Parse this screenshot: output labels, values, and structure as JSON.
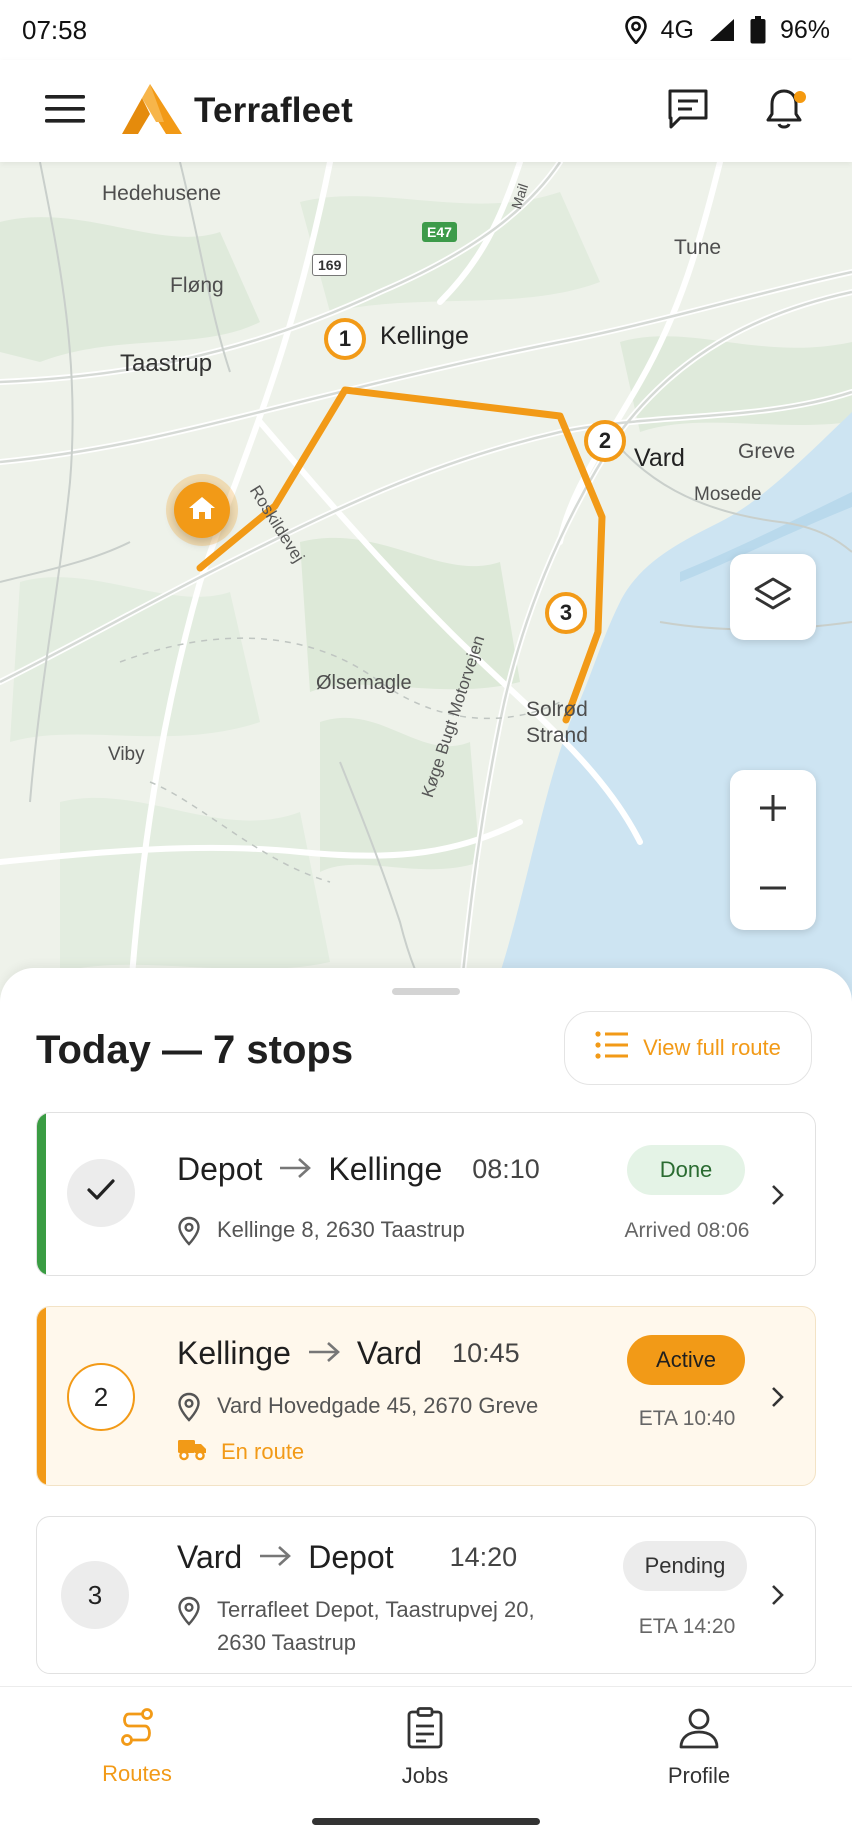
{
  "status_bar": {
    "time": "07:58",
    "network": "4G",
    "battery": "96%",
    "icons": [
      "location-icon",
      "signal-icon",
      "battery-icon"
    ]
  },
  "app_bar": {
    "brand": "Terrafleet",
    "icons": [
      "menu-icon",
      "logo-icon",
      "messages-icon",
      "notifications-icon"
    ],
    "notification_dot_color": "#f59a10"
  },
  "map": {
    "places": {
      "hedehusene": "Hedehusene",
      "flong": "Fløng",
      "taastrup": "Taastrup",
      "kellinge": "Kellinge",
      "tune": "Tune",
      "vard": "Vard",
      "greve": "Greve",
      "mosede": "Mosede",
      "olsemagle": "Ølsemagle",
      "viby": "Viby",
      "solrod_line1": "Solrød",
      "solrod_line2": "Strand"
    },
    "roads": {
      "roskildevej": "Roskildevej",
      "koge_bugt": "Køge Bugt Motorvejen",
      "top_road": "Mail"
    },
    "shields": {
      "e47": "E47",
      "r169": "169"
    },
    "markers": [
      "1",
      "2",
      "3"
    ],
    "route_color": "#f29a17",
    "controls": [
      "layers-icon",
      "zoom-in-icon",
      "zoom-out-icon"
    ]
  },
  "sheet": {
    "title": "Today — 7 stops",
    "view_route_label": "View full route",
    "stops": [
      {
        "number": "",
        "from": "Depot",
        "to": "Kellinge",
        "time": "08:10",
        "address": "Kellinge 8, 2630 Taastrup",
        "badge": "Done",
        "eta": "Arrived 08:06",
        "state": "done",
        "accent": "#3a9c43"
      },
      {
        "number": "2",
        "from": "Kellinge",
        "to": "Vard",
        "time": "10:45",
        "address": "Vard Hovedgade 45, 2670 Greve",
        "status": "En route",
        "badge": "Active",
        "eta": "ETA 10:40",
        "state": "active",
        "accent": "#f29a17"
      },
      {
        "number": "3",
        "from": "Vard",
        "to": "Depot",
        "time": "14:20",
        "address_line1": "Terrafleet Depot, Taastrupvej 20,",
        "address_line2": "2630 Taastrup",
        "badge": "Pending",
        "eta": "ETA 14:20",
        "state": "pending"
      }
    ]
  },
  "bottom_nav": {
    "items": [
      {
        "label": "Routes",
        "icon": "routes-icon",
        "active": true
      },
      {
        "label": "Jobs",
        "icon": "clipboard-icon",
        "active": false
      },
      {
        "label": "Profile",
        "icon": "person-icon",
        "active": false
      }
    ]
  }
}
